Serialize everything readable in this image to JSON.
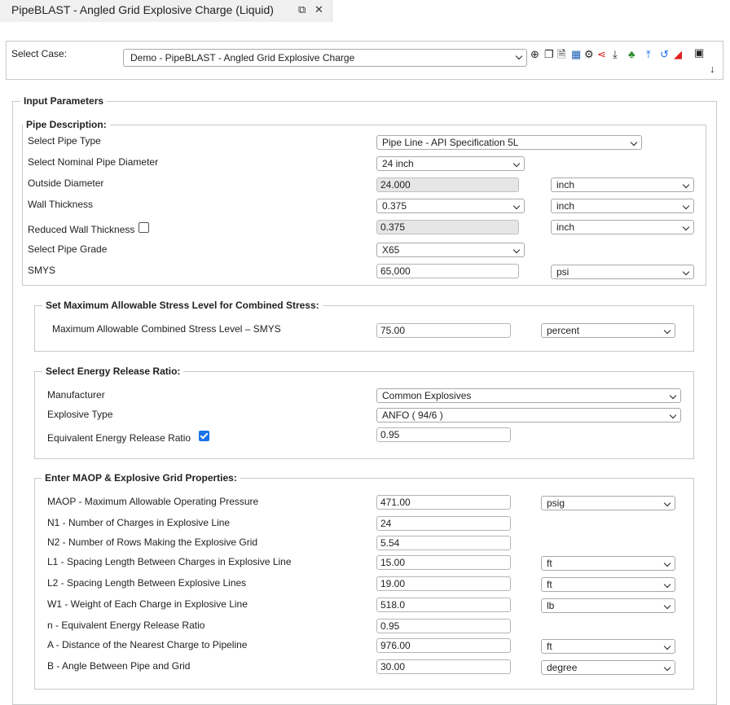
{
  "tab": {
    "title": "PipeBLAST - Angled Grid Explosive Charge (Liquid)"
  },
  "case": {
    "label": "Select Case:",
    "selected": "Demo - PipeBLAST - Angled Grid Explosive Charge"
  },
  "input_parameters": {
    "legend": "Input Parameters"
  },
  "pipe": {
    "legend": "Pipe Description:",
    "pipe_type_label": "Select Pipe Type",
    "pipe_type": "Pipe Line - API Specification 5L",
    "diameter_label": "Select Nominal Pipe Diameter",
    "diameter": "24 inch",
    "od_label": "Outside Diameter",
    "od": "24.000",
    "od_unit": "inch",
    "wt_label": "Wall Thickness",
    "wt": "0.375",
    "wt_unit": "inch",
    "rwt_label": "Reduced Wall Thickness",
    "rwt": "0.375",
    "rwt_unit": "inch",
    "grade_label": "Select Pipe Grade",
    "grade": "X65",
    "smys_label": "SMYS",
    "smys": "65,000",
    "smys_unit": "psi"
  },
  "stress": {
    "legend": "Set Maximum Allowable Stress Level for Combined Stress:",
    "label": "Maximum Allowable Combined Stress Level – SMYS",
    "value": "75.00",
    "unit": "percent"
  },
  "energy": {
    "legend": "Select Energy Release Ratio:",
    "manufacturer_label": "Manufacturer",
    "manufacturer": "Common Explosives",
    "explosive_label": "Explosive Type",
    "explosive": "ANFO ( 94/6 )",
    "ratio_label": "Equivalent Energy Release Ratio",
    "ratio": "0.95"
  },
  "maop": {
    "legend": "Enter MAOP & Explosive Grid Properties:",
    "rows": [
      {
        "label": "MAOP - Maximum Allowable Operating Pressure",
        "value": "471.00",
        "unit": "psig"
      },
      {
        "label": "N1 - Number of Charges in Explosive Line",
        "value": "24"
      },
      {
        "label": "N2 - Number of Rows Making the Explosive Grid",
        "value": "5.54"
      },
      {
        "label": "L1 - Spacing Length Between Charges in Explosive Line",
        "value": "15.00",
        "unit": "ft"
      },
      {
        "label": "L2 - Spacing Length Between Explosive Lines",
        "value": "19.00",
        "unit": "ft"
      },
      {
        "label": "W1 - Weight of Each Charge in Explosive Line",
        "value": "518.0",
        "unit": "lb"
      },
      {
        "label": "n - Equivalent Energy Release Ratio",
        "value": "0.95"
      },
      {
        "label": "A - Distance of the Nearest Charge to Pipeline",
        "value": "976.00",
        "unit": "ft"
      },
      {
        "label": "B - Angle Between Pipe and Grid",
        "value": "30.00",
        "unit": "degree"
      }
    ]
  },
  "colors": {
    "accent_blue": "#1a73e8",
    "share_red": "#e02020",
    "green": "#2e8b2e",
    "chart_red": "#e02020"
  }
}
